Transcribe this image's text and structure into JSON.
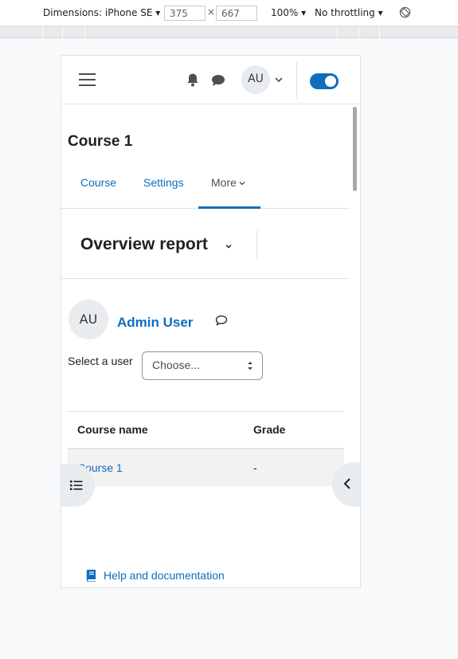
{
  "devtools": {
    "dimensions": "Dimensions: iPhone SE",
    "width": "375",
    "times": "×",
    "height": "667",
    "zoom": "100%",
    "throttling": "No throttling"
  },
  "navbar": {
    "avatar_initials": "AU"
  },
  "course": {
    "title": "Course 1"
  },
  "tabs": [
    {
      "label": "Course"
    },
    {
      "label": "Settings"
    },
    {
      "label": "More"
    }
  ],
  "report": {
    "title": "Overview report"
  },
  "user": {
    "initials": "AU",
    "name": "Admin User"
  },
  "user_select": {
    "label": "Select a user",
    "value": "Choose..."
  },
  "grades_table": {
    "headers": [
      "Course name",
      "Grade"
    ],
    "rows": [
      {
        "course": "Course 1",
        "grade": "-"
      }
    ]
  },
  "footer": {
    "help_label": "Help and documentation"
  },
  "colors": {
    "brand": "#0f6cbf",
    "text": "#1d2125"
  }
}
